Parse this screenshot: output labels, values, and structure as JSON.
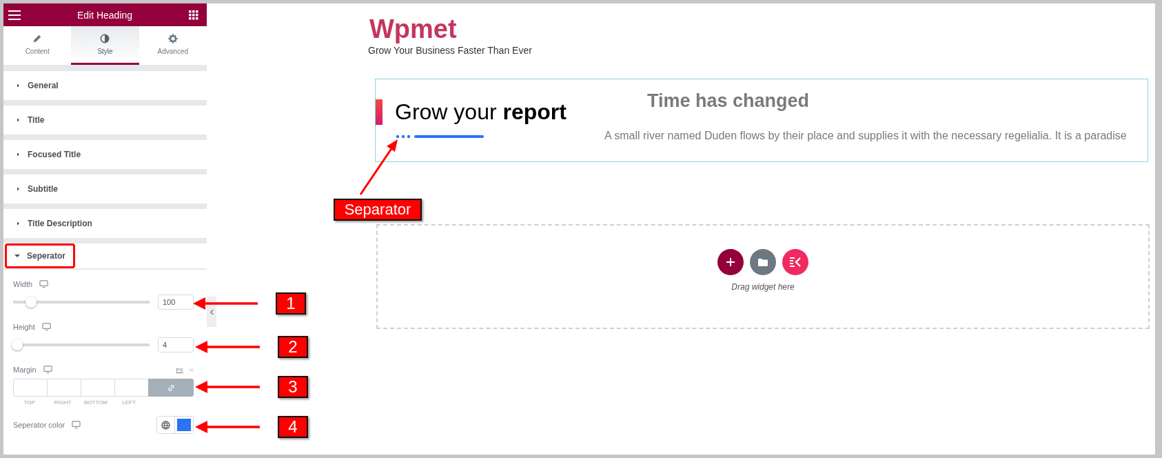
{
  "panel": {
    "title": "Edit Heading",
    "tabs": [
      {
        "label": "Content",
        "selected": false
      },
      {
        "label": "Style",
        "selected": true
      },
      {
        "label": "Advanced",
        "selected": false
      }
    ],
    "sections": [
      {
        "label": "General",
        "expanded": false,
        "highlighted": false
      },
      {
        "label": "Title",
        "expanded": false,
        "highlighted": false
      },
      {
        "label": "Focused Title",
        "expanded": false,
        "highlighted": false
      },
      {
        "label": "Subtitle",
        "expanded": false,
        "highlighted": false
      },
      {
        "label": "Title Description",
        "expanded": false,
        "highlighted": false
      },
      {
        "label": "Seperator",
        "expanded": true,
        "highlighted": true
      }
    ],
    "controls": [
      {
        "kind": "slider",
        "label": "Width",
        "value": "100",
        "level": 0.1
      },
      {
        "kind": "slider",
        "label": "Height",
        "value": "4",
        "level": 0
      },
      {
        "kind": "dimensions",
        "label": "Margin",
        "units": [
          {
            "label": "PX",
            "selected": true
          },
          {
            "label": "%",
            "selected": false
          }
        ],
        "sides": [
          "TOP",
          "RIGHT",
          "BOTTOM",
          "LEFT"
        ],
        "linked": true
      },
      {
        "kind": "color",
        "label": "Seperator color",
        "color": "#2a74f2"
      }
    ]
  },
  "canvas": {
    "logo": "Wpmet",
    "tagline": "Grow Your Business Faster Than Ever",
    "heading": {
      "text": "Grow your **report**"
    },
    "aside": {
      "title": "Time has changed",
      "text": "A small river named Duden flows by their place and supplies it with the necessary regelialia. It is a paradise"
    },
    "dropzone": {
      "hint": "Drag widget here"
    }
  },
  "annotations": [
    {
      "kind": "label",
      "text": "Separator"
    },
    {
      "kind": "number",
      "text": "1"
    },
    {
      "kind": "number",
      "text": "2"
    },
    {
      "kind": "number",
      "text": "3"
    },
    {
      "kind": "number",
      "text": "4"
    }
  ]
}
